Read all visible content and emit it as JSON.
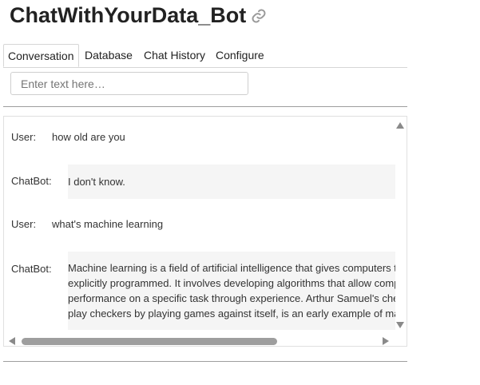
{
  "app": {
    "title": "ChatWithYourData_Bot",
    "link_icon": "link-icon"
  },
  "tabs": [
    {
      "label": "Conversation",
      "active": true
    },
    {
      "label": "Database",
      "active": false
    },
    {
      "label": "Chat History",
      "active": false
    },
    {
      "label": "Configure",
      "active": false
    }
  ],
  "input": {
    "placeholder": "Enter text here…",
    "value": ""
  },
  "conversation": [
    {
      "speaker": "User:",
      "text": "how old are you"
    },
    {
      "speaker": "ChatBot:",
      "text": "I don't know."
    },
    {
      "speaker": "User:",
      "text": "what's machine learning"
    },
    {
      "speaker": "ChatBot:",
      "text": "Machine learning is a field of artificial intelligence that gives computers t\nexplicitly programmed. It involves developing algorithms that allow comp\nperformance on a specific task through experience. Arthur Samuel's che\nplay checkers by playing games against itself, is an early example of ma"
    }
  ],
  "colors": {
    "bot_bubble": "#f5f5f5",
    "scrollbar": "#9e9e9e"
  }
}
